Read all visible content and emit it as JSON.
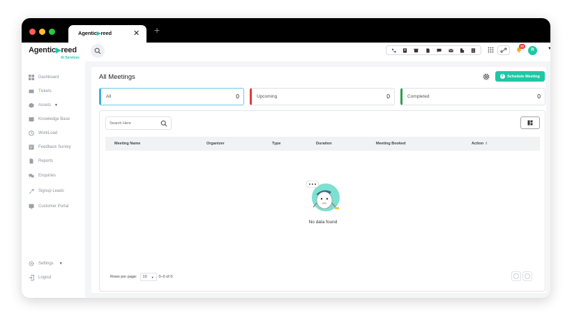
{
  "browser": {
    "tab_title_prefix": "Agentic",
    "tab_title_suffix": "reed",
    "new_tab": "+",
    "close": "✕"
  },
  "header": {
    "logo_prefix": "Agentic",
    "logo_suffix": "reed",
    "logo_sub": "AI Services",
    "notification_count": "20",
    "avatar_initial": "R",
    "toolbar_icons": [
      "phone-icon",
      "contact-icon",
      "store-icon",
      "document-icon",
      "chat-icon",
      "mail-icon",
      "building-icon",
      "notes-icon"
    ]
  },
  "sidebar": {
    "items": [
      {
        "label": "Dashboard",
        "icon": "dashboard-icon"
      },
      {
        "label": "Tickets",
        "icon": "ticket-icon"
      },
      {
        "label": "Assets",
        "icon": "assets-icon",
        "caret": "▼"
      },
      {
        "label": "Knowledge Base",
        "icon": "book-icon"
      },
      {
        "label": "WorkLoad",
        "icon": "workload-icon"
      },
      {
        "label": "Feedback Survey",
        "icon": "survey-icon"
      },
      {
        "label": "Reports",
        "icon": "reports-icon"
      },
      {
        "label": "Enquiries",
        "icon": "enquiries-icon"
      },
      {
        "label": "Signup Leads",
        "icon": "leads-icon"
      },
      {
        "label": "Customer Portal",
        "icon": "portal-icon"
      }
    ],
    "settings": {
      "label": "Settings",
      "caret": "▼"
    },
    "logout": {
      "label": "Logout"
    }
  },
  "main": {
    "title": "All Meetings",
    "schedule_label": "Schedule Meeting",
    "stats": [
      {
        "label": "All",
        "count": "0",
        "color": "#3bb1dc"
      },
      {
        "label": "Upcoming",
        "count": "0",
        "color": "#e53935"
      },
      {
        "label": "Completed",
        "count": "0",
        "color": "#2e9e4f"
      }
    ],
    "search_placeholder": "Search Here",
    "columns": [
      "Meeting Name",
      "Organizer",
      "Type",
      "Duration",
      "Meeting Booked",
      "Action"
    ],
    "empty_text": "No data found",
    "rows_per_page_label": "Rows per page:",
    "rows_per_page_value": "10",
    "range_text": "0–0 of 0"
  },
  "colors": {
    "accent": "#1ec8a5"
  }
}
